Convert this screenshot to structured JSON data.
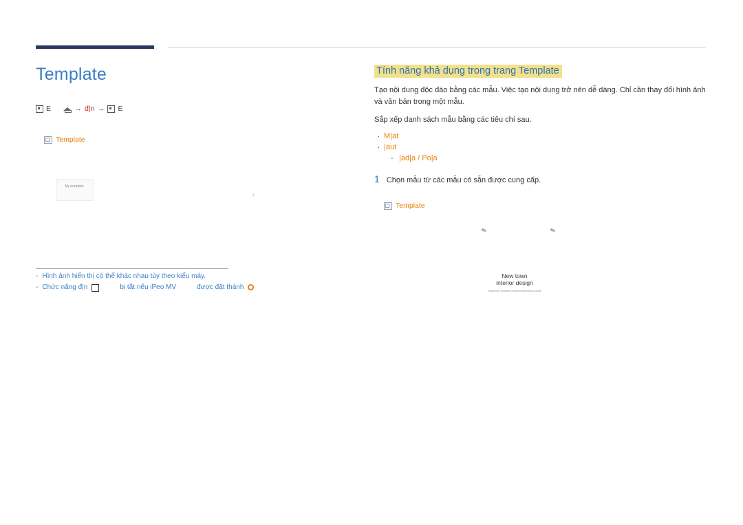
{
  "page": {
    "chapter_title": "Template",
    "menu_path": {
      "start_icon": "screen-icon",
      "start_label": "E",
      "home_icon": "home-icon",
      "step1": "đ|n",
      "arrow": "→",
      "end_icon": "screen-icon",
      "end_label": "E"
    },
    "left_panel": {
      "label": "Template",
      "label_icon": "window-icon",
      "thumbnail_caption": "My template",
      "chevron_icon": "chevron-right-icon"
    },
    "notes": [
      {
        "dash": "-",
        "text": "Hình ảnh hiển thị có thể khác nhau tùy theo kiểu máy."
      },
      {
        "dash": "-",
        "text_a": "Chức năng đ|n",
        "text_b": "bị tắt nếu iPeo MV",
        "text_c": "được đặt thành",
        "icon": "gear-icon"
      }
    ],
    "right_panel": {
      "title": "Tính năng khả dụng trong trang Template",
      "paragraph_1": "Tạo nội dung độc đáo bằng các mẫu. Việc tạo nội dung trở nên dễ dàng. Chỉ cần thay đổi hình ảnh và văn bản trong một mẫu.",
      "paragraph_2": "Sắp xếp danh sách mẫu bằng các tiêu chí sau.",
      "bullets": [
        "M|at",
        "|aut"
      ],
      "sub_bullets": [
        "|ad|a / Po|a"
      ],
      "step": {
        "number": "1",
        "text": "Chọn mẫu từ các mẫu có sẵn được cung cấp."
      },
      "screenshot_label": "Template",
      "screenshot_label_icon": "window-icon",
      "mock_card": {
        "line1": "New town",
        "line2": "interior design",
        "line3": "Subscribe nowtake unlimited amounts change"
      },
      "pen_icon": "pencil-icon"
    }
  }
}
